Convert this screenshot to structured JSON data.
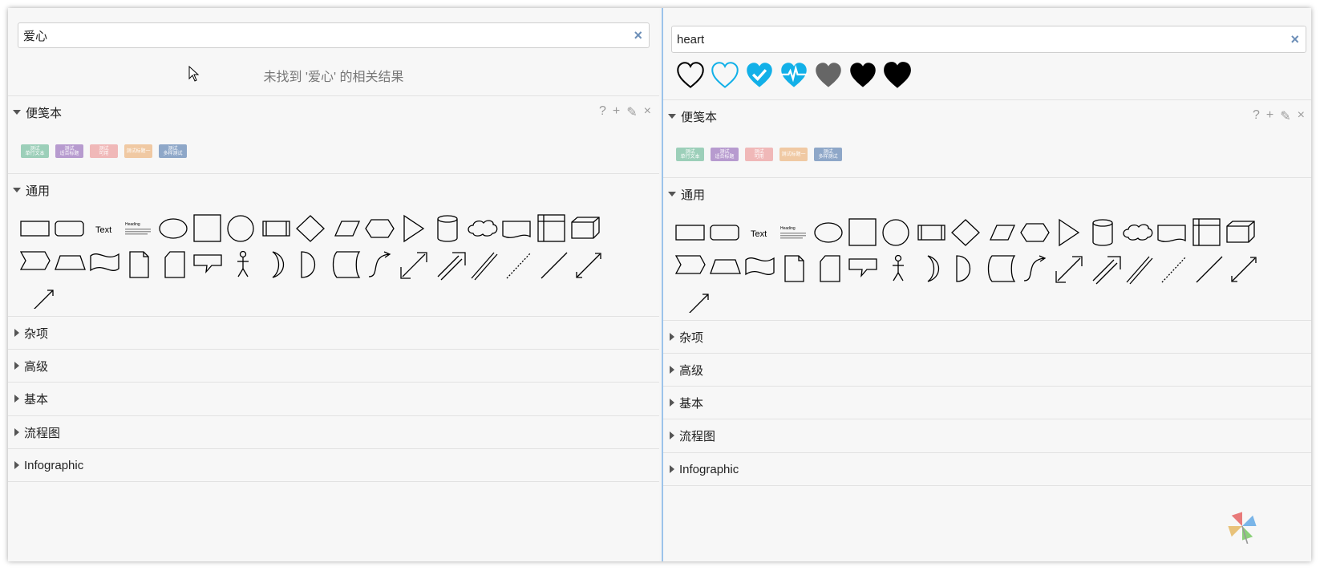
{
  "left_panel": {
    "search": {
      "value": "爱心",
      "clear_label": "×"
    },
    "no_result": "未找到 '爱心' 的相关结果"
  },
  "right_panel": {
    "search": {
      "value": "heart",
      "clear_label": "×"
    },
    "heart_results": [
      "heart-outline-icon",
      "heart-outline-blue-icon",
      "heart-check-icon",
      "heart-pulse-icon",
      "heart-gray-icon",
      "heart-black-icon",
      "heart-black-large-icon"
    ]
  },
  "sections": {
    "notebook": {
      "title": "便笺本",
      "tools": {
        "help": "?",
        "add": "+",
        "edit": "✎",
        "close": "×"
      }
    },
    "general": {
      "title": "通用"
    },
    "misc": {
      "title": "杂项"
    },
    "advanced": {
      "title": "高级"
    },
    "basic": {
      "title": "基本"
    },
    "flowchart": {
      "title": "流程图"
    },
    "infographic": {
      "title": "Infographic"
    }
  },
  "notes": [
    {
      "label": "测试\n单行文本",
      "color": "#9ccfb9"
    },
    {
      "label": "测试\n适合标题",
      "color": "#b79bcf"
    },
    {
      "label": "测试\n可用",
      "color": "#f0b8b8"
    },
    {
      "label": "测试标题一",
      "color": "#f0c9a3"
    },
    {
      "label": "测试\n多样测试",
      "color": "#8ea7c8"
    }
  ],
  "general_shapes": {
    "text_label": "Text",
    "heading_label": "Heading"
  },
  "colors": {
    "accent_blue": "#12b0e8",
    "clear_icon": "#6d8fb8",
    "panel_border": "#9cc3ea"
  }
}
